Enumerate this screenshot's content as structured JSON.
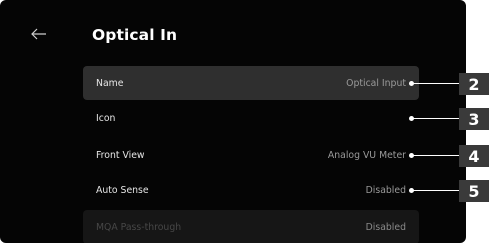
{
  "header": {
    "title": "Optical In",
    "back_icon": "arrow-left-icon"
  },
  "settings": [
    {
      "label": "Name",
      "value": "Optical Input",
      "selected": true
    },
    {
      "label": "Icon",
      "value": ""
    },
    {
      "label": "Front View",
      "value": "Analog VU Meter"
    },
    {
      "label": "Auto Sense",
      "value": "Disabled"
    },
    {
      "label": "MQA Pass-through",
      "value": "Disabled",
      "dimmed": true
    }
  ],
  "callouts": [
    "2",
    "3",
    "4",
    "5"
  ]
}
